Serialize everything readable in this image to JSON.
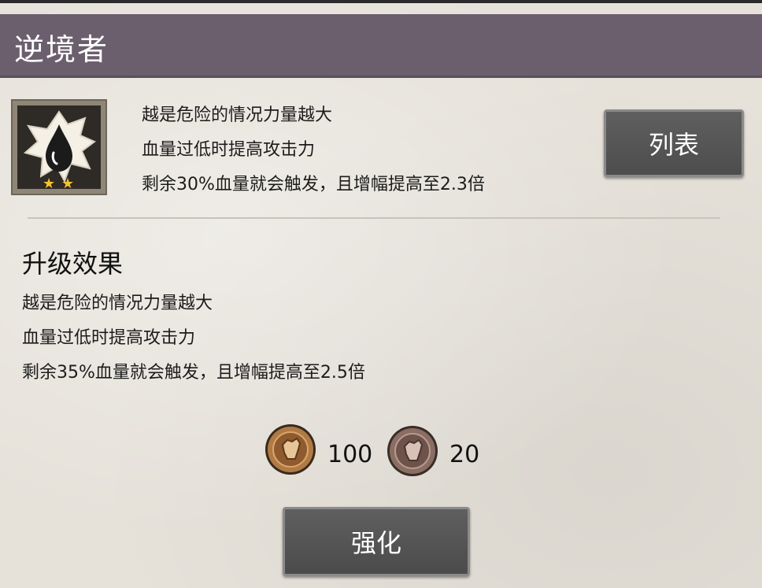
{
  "title": "逆境者",
  "skill": {
    "stars": 2,
    "current_desc": [
      "越是危险的情况力量越大",
      "血量过低时提高攻击力",
      "剩余30%血量就会触发，且增幅提高至2.3倍"
    ]
  },
  "list_button_label": "列表",
  "upgrade": {
    "heading": "升级效果",
    "desc": [
      "越是危险的情况力量越大",
      "血量过低时提高攻击力",
      "剩余35%血量就会触发，且增幅提高至2.5倍"
    ]
  },
  "costs": [
    {
      "icon": "bronze-fist-coin-icon",
      "value": "100",
      "color": "#b07a45"
    },
    {
      "icon": "gray-fist-coin-icon",
      "value": "20",
      "color": "#8a6e63"
    }
  ],
  "enhance_button_label": "强化",
  "colors": {
    "title_bar": "#6b5f6e",
    "background": "#e6e2da",
    "button": "#555555"
  }
}
